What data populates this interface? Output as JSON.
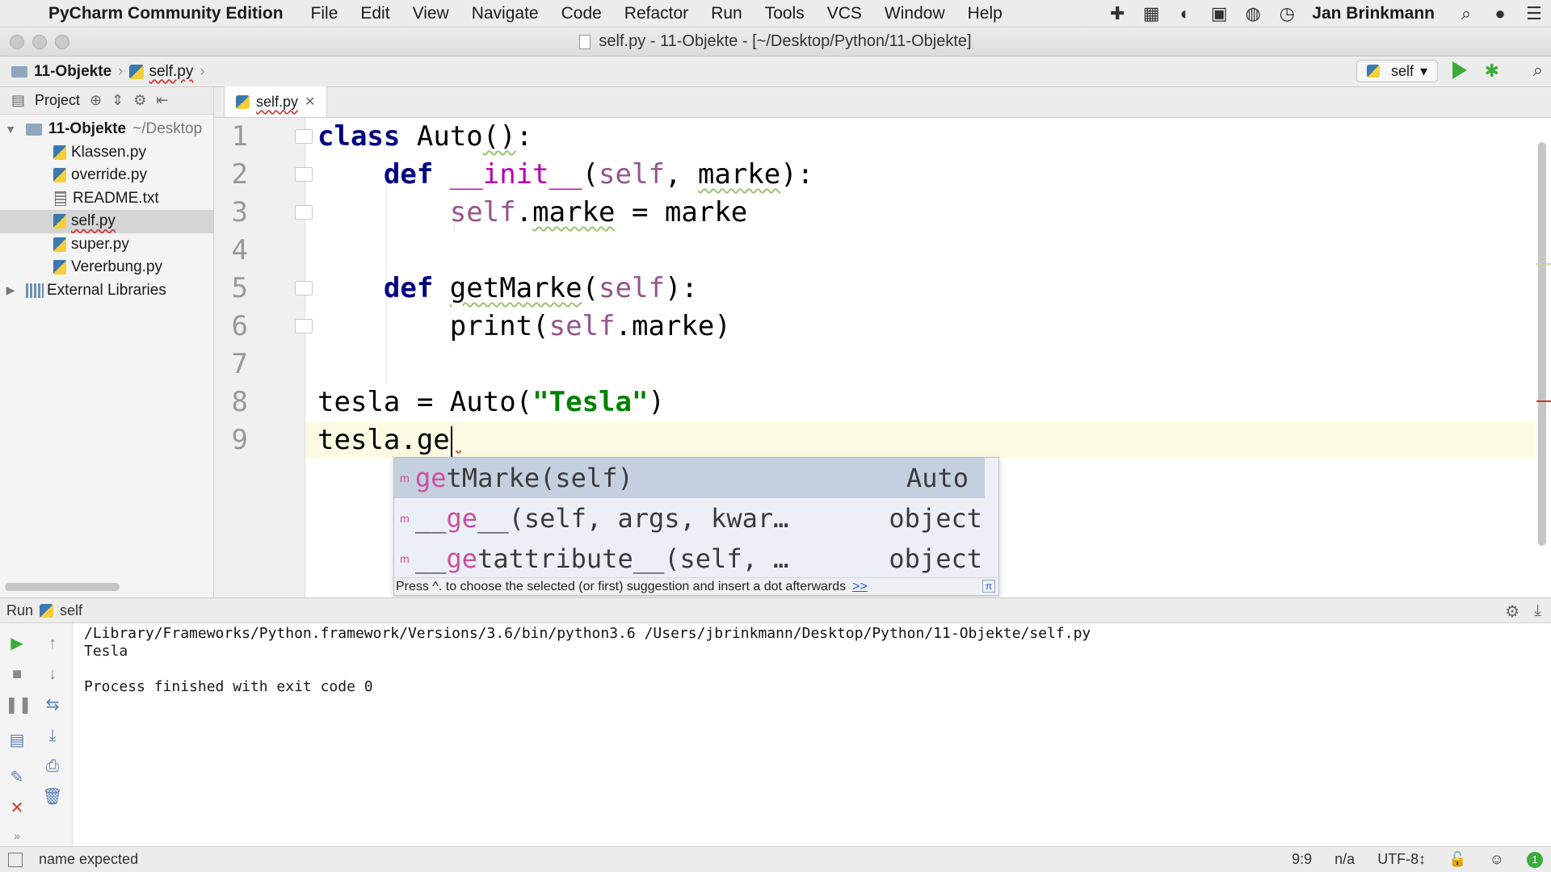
{
  "menubar": {
    "app_name": "PyCharm Community Edition",
    "items": [
      "File",
      "Edit",
      "View",
      "Navigate",
      "Code",
      "Refactor",
      "Run",
      "Tools",
      "VCS",
      "Window",
      "Help"
    ],
    "user": "Jan Brinkmann"
  },
  "window": {
    "title": "self.py - 11-Objekte - [~/Desktop/Python/11-Objekte]"
  },
  "navbar": {
    "project": "11-Objekte",
    "file": "self.py",
    "run_config": "self"
  },
  "project_panel": {
    "header": "Project",
    "root": {
      "name": "11-Objekte",
      "path": "~/Desktop"
    },
    "files": [
      {
        "name": "Klassen.py",
        "type": "py"
      },
      {
        "name": "override.py",
        "type": "py"
      },
      {
        "name": "README.txt",
        "type": "txt"
      },
      {
        "name": "self.py",
        "type": "py",
        "selected": true
      },
      {
        "name": "super.py",
        "type": "py"
      },
      {
        "name": "Vererbung.py",
        "type": "py"
      }
    ],
    "external": "External Libraries"
  },
  "editor": {
    "tab": "self.py",
    "line_numbers": [
      "1",
      "2",
      "3",
      "4",
      "5",
      "6",
      "7",
      "8",
      "9"
    ],
    "tokens": {
      "class_kw": "class",
      "class_name": "Auto",
      "def_kw": "def",
      "init": "__init__",
      "self": "self",
      "marke": "marke",
      "getMarke": "getMarke",
      "print": "print",
      "tesla": "tesla",
      "tesla_str": "\"Tesla\"",
      "typed": "tesla.ge"
    }
  },
  "completion": {
    "items": [
      {
        "prefix": "ge",
        "rest": "tMarke(self)",
        "pre": "",
        "type": "Auto"
      },
      {
        "prefix": "ge",
        "rest": "__(self, args, kwar…",
        "pre": "__",
        "type": "object"
      },
      {
        "prefix": "ge",
        "rest": "tattribute__(self, …",
        "pre": "__",
        "type": "object"
      }
    ],
    "footer": "Press ^. to choose the selected (or first) suggestion and insert a dot afterwards",
    "footer_link": ">>"
  },
  "run_panel": {
    "label": "Run",
    "config": "self",
    "command": "/Library/Frameworks/Python.framework/Versions/3.6/bin/python3.6 /Users/jbrinkmann/Desktop/Python/11-Objekte/self.py",
    "output": "Tesla",
    "exit": "Process finished with exit code 0"
  },
  "statusbar": {
    "message": "name expected",
    "position": "9:9",
    "na": "n/a",
    "encoding": "UTF-8↕",
    "badge": "1"
  },
  "colors": {
    "keyword": "#000080",
    "self": "#94558d",
    "string": "#008000",
    "current_line": "#fdfbe3",
    "completion_match": "#cc4f9f"
  },
  "icons": {
    "run": "play-triangle-icon",
    "debug": "bug-icon",
    "search": "magnifier-icon"
  }
}
